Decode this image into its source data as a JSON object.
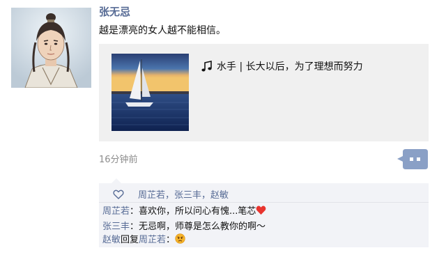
{
  "post": {
    "author": "张无忌",
    "text": "越是漂亮的女人越不能相信。",
    "share": {
      "title": "水手 | 长大以后，为了理想而努力"
    },
    "time": "16分钟前"
  },
  "likes": {
    "names": "周芷若，张三丰，赵敏"
  },
  "comments": [
    {
      "name": "周芷若",
      "sep": "：",
      "text": "喜欢你，所以问心有愧...笔芯"
    },
    {
      "name": "张三丰",
      "sep": "：",
      "text": "无忌啊，师尊是怎么教你的啊～"
    },
    {
      "name": "赵敏",
      "reply_word": "回复",
      "reply_to": "周芷若",
      "sep": "："
    }
  ],
  "colors": {
    "name_link": "#576b95",
    "card_bg": "#f0f0f0",
    "comment_bg": "#f2f3f7"
  },
  "icons": [
    "music-note-icon",
    "heart-outline-icon",
    "comment-dots-icon",
    "red-heart-emoji",
    "angry-face-emoji"
  ]
}
